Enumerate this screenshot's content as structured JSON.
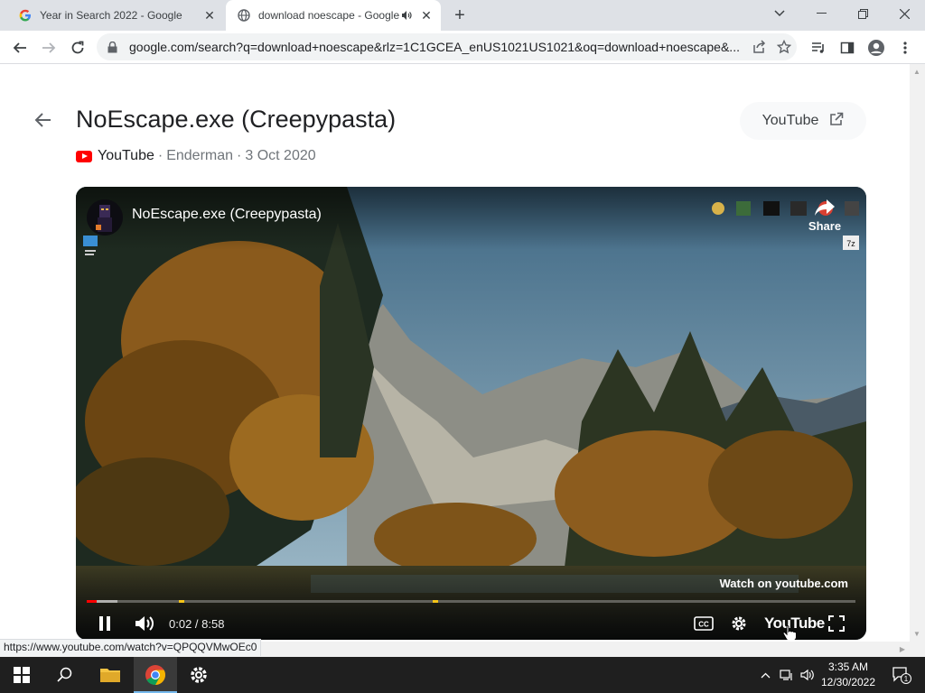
{
  "browser": {
    "tabs": [
      {
        "title": "Year in Search 2022 - Google",
        "active": false,
        "icon": "google-g-icon"
      },
      {
        "title": "download noescape - Google",
        "active": true,
        "icon": "globe-icon",
        "audio": true
      }
    ],
    "new_tab": "+",
    "url": "google.com/search?q=download+noescape&rlz=1C1GCEA_enUS1021US1021&oq=download+noescape&..."
  },
  "result": {
    "title": "NoEscape.exe (Creepypasta)",
    "source": "YouTube",
    "channel": "Enderman",
    "date": "3 Oct 2020",
    "separator": "·",
    "open_button": "YouTube"
  },
  "player": {
    "title": "NoEscape.exe (Creepypasta)",
    "share_label": "Share",
    "watch_on": "Watch on youtube.com",
    "time": "0:02 / 8:58",
    "progress_played": 0.004,
    "progress_loaded": 0.04,
    "youtube_label": "YouTube"
  },
  "status_link": "https://www.youtube.com/watch?v=QPQQVMwOEc0",
  "taskbar": {
    "time": "3:35 AM",
    "date": "12/30/2022",
    "notification_count": "1"
  },
  "colors": {
    "accent_red": "#ff0000",
    "taskbar": "#1f1f1f",
    "tab_strip": "#dee1e6"
  }
}
